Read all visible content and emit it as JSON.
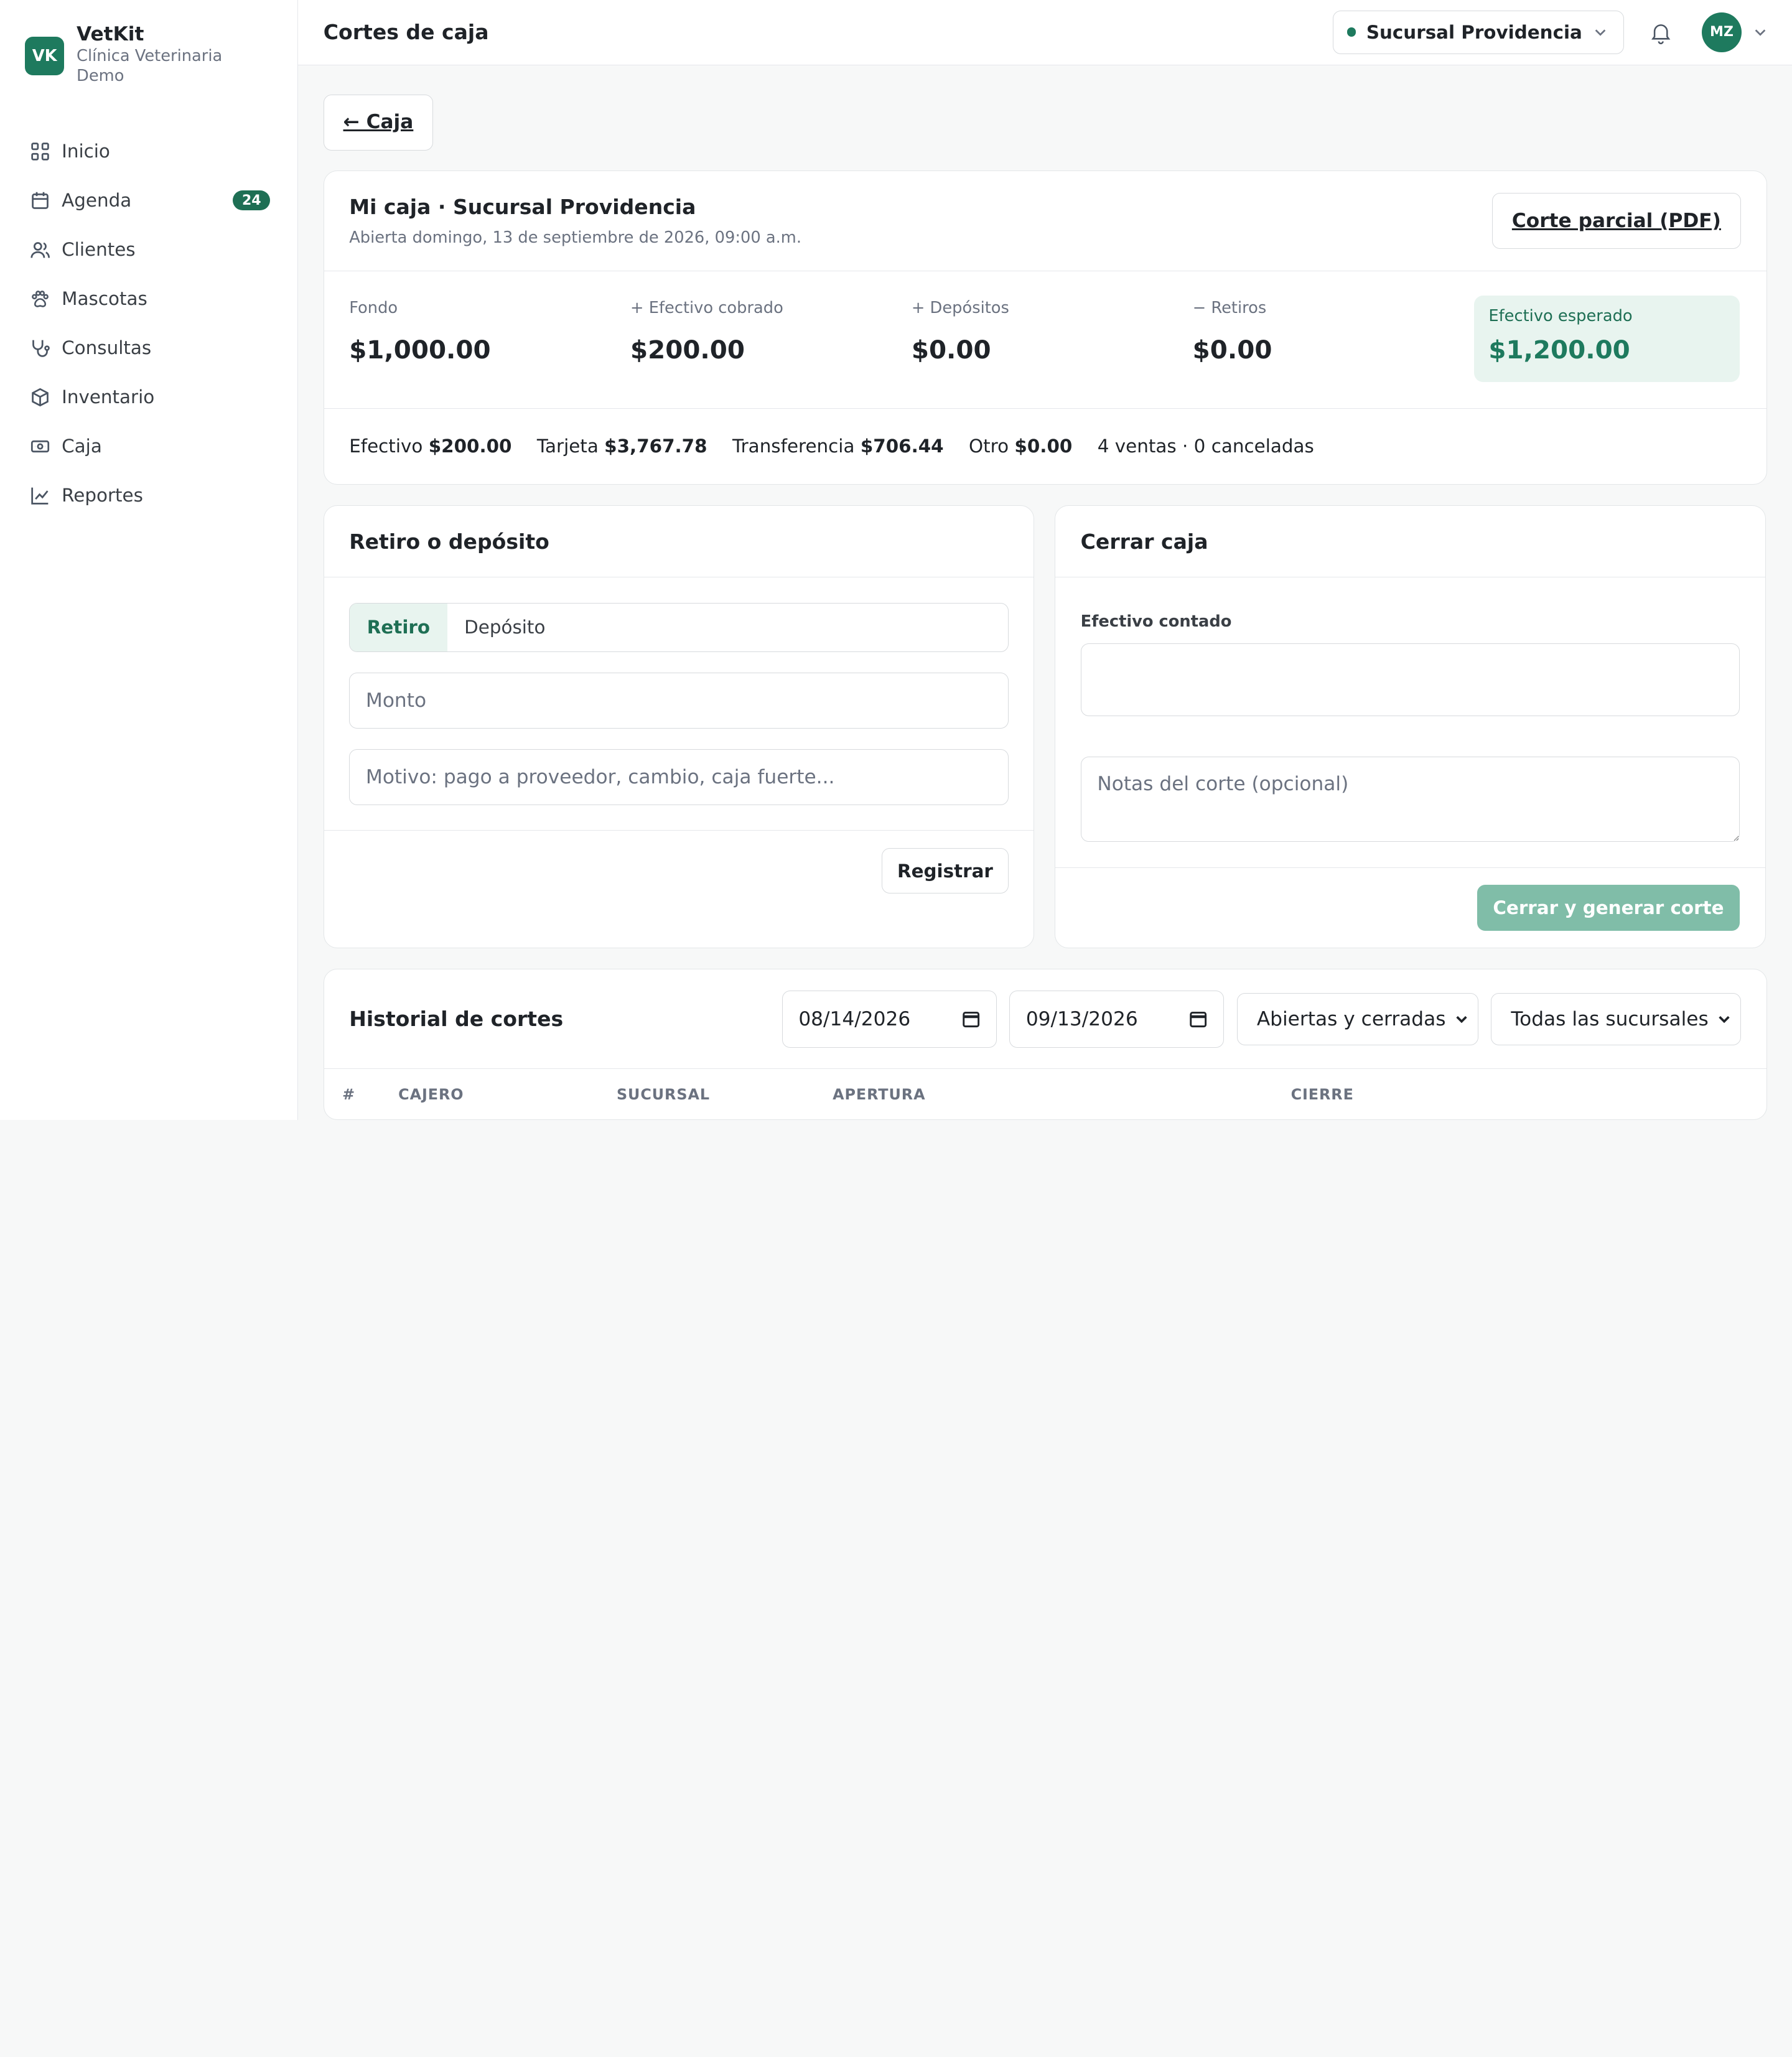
{
  "brand": {
    "logo": "VK",
    "name": "VetKit",
    "subtitle": "Clínica Veterinaria Demo"
  },
  "sidebar": {
    "items": [
      {
        "label": "Inicio",
        "icon": "grid-icon"
      },
      {
        "label": "Agenda",
        "icon": "calendar-icon",
        "badge": "24"
      },
      {
        "label": "Clientes",
        "icon": "users-icon"
      },
      {
        "label": "Mascotas",
        "icon": "paw-icon"
      },
      {
        "label": "Consultas",
        "icon": "stethoscope-icon"
      },
      {
        "label": "Inventario",
        "icon": "box-icon"
      },
      {
        "label": "Caja",
        "icon": "cash-icon"
      },
      {
        "label": "Reportes",
        "icon": "chart-icon"
      }
    ]
  },
  "header": {
    "title": "Cortes de caja",
    "branch": "Sucursal Providencia",
    "avatar": "MZ"
  },
  "back_label": "← Caja",
  "summary": {
    "title": "Mi caja · Sucursal Providencia",
    "subtitle": "Abierta domingo, 13 de septiembre de 2026, 09:00 a.m.",
    "pdf_label": "Corte parcial (PDF)",
    "stats": [
      {
        "label": "Fondo",
        "value": "$1,000.00"
      },
      {
        "label": "+ Efectivo cobrado",
        "value": "$200.00"
      },
      {
        "label": "+ Depósitos",
        "value": "$0.00"
      },
      {
        "label": "− Retiros",
        "value": "$0.00"
      }
    ],
    "expected": {
      "label": "Efectivo esperado",
      "value": "$1,200.00"
    },
    "methods": [
      {
        "label": "Efectivo",
        "value": "$200.00"
      },
      {
        "label": "Tarjeta",
        "value": "$3,767.78"
      },
      {
        "label": "Transferencia",
        "value": "$706.44"
      },
      {
        "label": "Otro",
        "value": "$0.00"
      }
    ],
    "sales_note": "4 ventas · 0 canceladas"
  },
  "movement": {
    "title": "Retiro o depósito",
    "tabs": [
      "Retiro",
      "Depósito"
    ],
    "amount_placeholder": "Monto",
    "reason_placeholder": "Motivo: pago a proveedor, cambio, caja fuerte...",
    "submit_label": "Registrar"
  },
  "close": {
    "title": "Cerrar caja",
    "counted_label": "Efectivo contado",
    "notes_placeholder": "Notas del corte (opcional)",
    "submit_label": "Cerrar y generar corte"
  },
  "history": {
    "title": "Historial de cortes",
    "date_from": "08/14/2026",
    "date_to": "09/13/2026",
    "status_filter": "Abiertas y cerradas",
    "branch_filter": "Todas las sucursales",
    "columns": [
      "#",
      "CAJERO",
      "SUCURSAL",
      "APERTURA",
      "CIERRE"
    ]
  },
  "colors": {
    "accent": "#1e7a5e",
    "accent_light": "#e8f4ef",
    "primary_disabled": "#80bda8"
  }
}
